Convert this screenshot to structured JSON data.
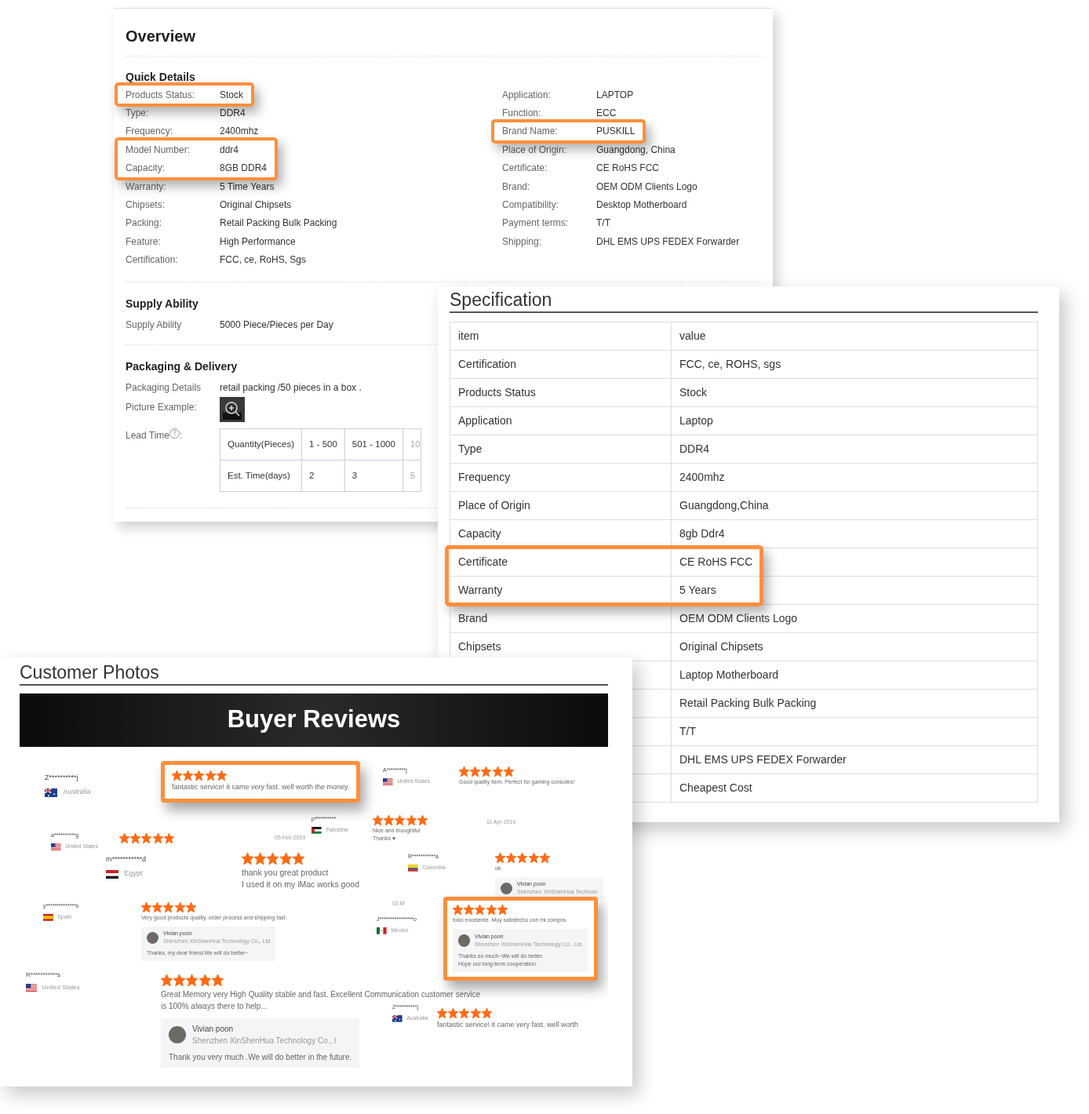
{
  "overview": {
    "title": "Overview",
    "quick_details": {
      "title": "Quick Details",
      "left": [
        {
          "label": "Products Status:",
          "value": "Stock",
          "highlighted": true
        },
        {
          "label": "Type:",
          "value": "DDR4",
          "highlighted": false
        },
        {
          "label": "Frequency:",
          "value": "2400mhz",
          "highlighted": false
        },
        {
          "label": "Model Number:",
          "value": "ddr4",
          "highlighted": true
        },
        {
          "label": "Capacity:",
          "value": "8GB DDR4",
          "highlighted": true
        },
        {
          "label": "Warranty:",
          "value": "5 Time Years",
          "highlighted": false
        },
        {
          "label": "Chipsets:",
          "value": "Original Chipsets",
          "highlighted": false
        },
        {
          "label": "Packing:",
          "value": "Retail Packing Bulk Packing",
          "highlighted": false
        },
        {
          "label": "Feature:",
          "value": "High Performance",
          "highlighted": false
        },
        {
          "label": "Certification:",
          "value": "FCC, ce, RoHS, Sgs",
          "highlighted": false
        }
      ],
      "right": [
        {
          "label": "Application:",
          "value": "LAPTOP",
          "highlighted": false
        },
        {
          "label": "Function:",
          "value": "ECC",
          "highlighted": false
        },
        {
          "label": "Brand Name:",
          "value": "PUSKILL",
          "highlighted": true
        },
        {
          "label": "Place of Origin:",
          "value": "Guangdong, China",
          "highlighted": false
        },
        {
          "label": "Certificate:",
          "value": "CE RoHS FCC",
          "highlighted": false
        },
        {
          "label": "Brand:",
          "value": "OEM ODM Clients Logo",
          "highlighted": false
        },
        {
          "label": "Compatibility:",
          "value": "Desktop Motherboard",
          "highlighted": false
        },
        {
          "label": "Payment terms:",
          "value": "T/T",
          "highlighted": false
        },
        {
          "label": "Shipping:",
          "value": "DHL EMS UPS FEDEX Forwarder",
          "highlighted": false
        }
      ]
    },
    "supply_ability": {
      "title": "Supply Ability",
      "label": "Supply Ability",
      "value": "5000 Piece/Pieces per Day"
    },
    "packaging_delivery": {
      "title": "Packaging & Delivery",
      "details_label": "Packaging Details",
      "details_value": "retail packing /50 pieces in a box .",
      "picture_label": "Picture Example:",
      "lead_time_label": "Lead Time",
      "lead_time_help": "?",
      "lead_time_suffix": ":",
      "lead_time_table": [
        [
          "Quantity(Pieces)",
          "1 - 500",
          "501 - 1000",
          "10"
        ],
        [
          "Est. Time(days)",
          "2",
          "3",
          "5"
        ]
      ]
    }
  },
  "specification": {
    "title": "Specification",
    "columns": [
      "item",
      "value"
    ],
    "rows": [
      {
        "item": "Certification",
        "value": "FCC, ce, ROHS, sgs",
        "highlighted": false
      },
      {
        "item": "Products Status",
        "value": "Stock",
        "highlighted": false
      },
      {
        "item": "Application",
        "value": "Laptop",
        "highlighted": false
      },
      {
        "item": "Type",
        "value": "DDR4",
        "highlighted": false
      },
      {
        "item": "Frequency",
        "value": "2400mhz",
        "highlighted": false
      },
      {
        "item": "Place of Origin",
        "value": "Guangdong,China",
        "highlighted": false
      },
      {
        "item": "Capacity",
        "value": "8gb Ddr4",
        "highlighted": false
      },
      {
        "item": "Certificate",
        "value": "CE RoHS FCC",
        "highlighted": true
      },
      {
        "item": "Warranty",
        "value": "5 Years",
        "highlighted": true
      },
      {
        "item": "Brand",
        "value": "OEM ODM Clients Logo",
        "highlighted": false
      },
      {
        "item": "Chipsets",
        "value": "Original Chipsets",
        "highlighted": false
      },
      {
        "value": "Laptop Motherboard",
        "highlighted": false
      },
      {
        "value": "Retail Packing Bulk Packing",
        "highlighted": false
      },
      {
        "value": "T/T",
        "highlighted": false
      },
      {
        "value": "DHL EMS UPS FEDEX Forwarder",
        "highlighted": false
      },
      {
        "value": "Cheapest Cost",
        "highlighted": false
      }
    ]
  },
  "customer_photos": {
    "title": "Customer Photos",
    "banner": "Buyer Reviews",
    "items": [
      {
        "kind": "reviewer",
        "name": "Z**********j",
        "country": "Australia"
      },
      {
        "kind": "review",
        "stars": 5,
        "text": [
          "fantastic service! it came very fast. well worth the money."
        ],
        "highlighted": true
      },
      {
        "kind": "reviewer",
        "name": "A*********j",
        "country": "United States"
      },
      {
        "kind": "review",
        "stars": 5,
        "text": [
          "Good quality item. Perfect for gaming consoles!"
        ],
        "highlighted": false
      },
      {
        "kind": "reviewer",
        "name": "a**********g",
        "country": "United States"
      },
      {
        "kind": "review",
        "stars": 5,
        "highlighted": false
      },
      {
        "kind": "date",
        "text": "05 Feb 2019"
      },
      {
        "kind": "reviewer",
        "name": "p**********",
        "country": "Palestine"
      },
      {
        "kind": "review",
        "stars": 5,
        "text": [
          "Nice and thoughtful",
          "Thanks ♥"
        ],
        "highlighted": false
      },
      {
        "kind": "date",
        "text": "11 Apr 2019"
      },
      {
        "kind": "reviewer",
        "name": "m***********d",
        "country": "Egypt"
      },
      {
        "kind": "review",
        "stars": 5,
        "text": [
          "thank you great product",
          "I used it on my iMac works good"
        ],
        "highlighted": false
      },
      {
        "kind": "reviewer",
        "name": "R***********a",
        "country": "Colombia"
      },
      {
        "kind": "review",
        "stars": 5,
        "text": [
          "ok"
        ],
        "highlighted": false,
        "reply": {
          "name": "Vivian poon",
          "company": "Shenzhen XinShenHua Technolo"
        }
      },
      {
        "kind": "reviewer",
        "name": "y**************s",
        "country": "Spain"
      },
      {
        "kind": "review",
        "stars": 5,
        "text": [
          "Very good products quality, order process and shipping fast."
        ],
        "highlighted": false,
        "reply": {
          "name": "Vivian poon",
          "company": "Shenzhen XinShenHua Technology Co., Ltd",
          "message": [
            "Thanks, my dear friend.We will do better~"
          ]
        }
      },
      {
        "kind": "date",
        "text": "03 M"
      },
      {
        "kind": "reviewer",
        "name": "J****************o",
        "country": "Mexico"
      },
      {
        "kind": "review",
        "stars": 5,
        "text": [
          "todo excelente. Muy satisfecho con mi compra."
        ],
        "highlighted": true,
        "reply": {
          "name": "Vivian poon",
          "company": "Shenzhen XinShenHua Technology Co., Ltd.",
          "message": [
            "Thanks so much~We will do better.",
            "Hope our long-term cooperation."
          ]
        }
      },
      {
        "kind": "reviewer",
        "name": "R***********s",
        "country": "United States"
      },
      {
        "kind": "review",
        "stars": 5,
        "text": [
          "Great Memory very High Quality stable and fast. Excellent Communication customer service",
          "is 100% always there to help..."
        ],
        "highlighted": false,
        "reply": {
          "name": "Vivian poon",
          "company": "Shenzhen XinShenHua Technology Co., l",
          "message": [
            "Thank you very much .We will do better in the future."
          ]
        }
      },
      {
        "kind": "reviewer",
        "name": "Z**********j",
        "country": "Australia"
      },
      {
        "kind": "review",
        "stars": 5,
        "text": [
          "fantastic service! it came very fast. well worth"
        ],
        "highlighted": false
      }
    ]
  }
}
